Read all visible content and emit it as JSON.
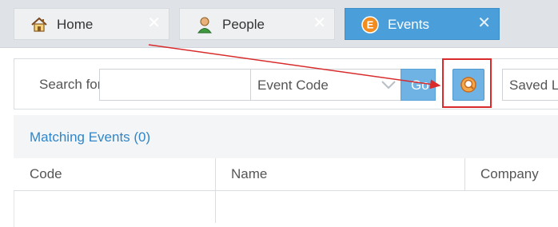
{
  "tabs": [
    {
      "label": "Home",
      "icon": "home-icon",
      "close": "✕"
    },
    {
      "label": "People",
      "icon": "person-icon",
      "close": "✕"
    },
    {
      "label": "Events",
      "icon": "events-icon",
      "icon_letter": "E",
      "close": "✕",
      "active": true
    }
  ],
  "search": {
    "label": "Search for:",
    "input_value": "",
    "type_selected": "Event Code",
    "go_label": "Go",
    "saved_list_label": "Saved Lis"
  },
  "results": {
    "title": "Matching Events (0)",
    "columns": [
      "Code",
      "Name",
      "Company"
    ]
  },
  "colors": {
    "accent": "#4a9fdb",
    "annotation_red": "#d92b2b",
    "link_blue": "#2f86c9"
  }
}
